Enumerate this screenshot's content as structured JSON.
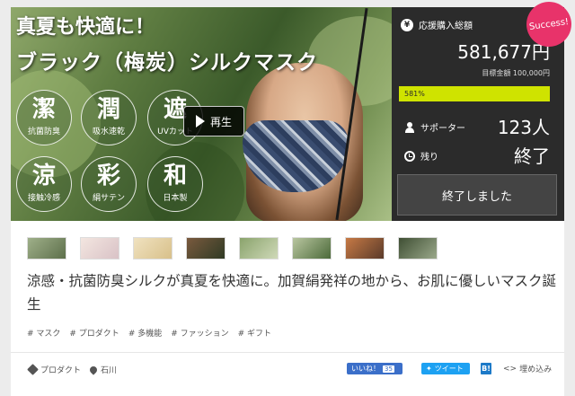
{
  "hero": {
    "title_line1": "真夏も快適に！",
    "title_line2": "ブラック（梅炭）シルクマスク",
    "play_label": "再生",
    "badges": [
      {
        "kanji": "潔",
        "sub": "抗菌防臭"
      },
      {
        "kanji": "潤",
        "sub": "吸水速乾"
      },
      {
        "kanji": "遮",
        "sub": "UVカット"
      },
      {
        "kanji": "涼",
        "sub": "接触冷感"
      },
      {
        "kanji": "彩",
        "sub": "絹サテン"
      },
      {
        "kanji": "和",
        "sub": "日本製"
      }
    ]
  },
  "panel": {
    "total_label": "応援購入総額",
    "amount": "581,677円",
    "goal": "目標金額 100,000円",
    "progress_label": "581%",
    "progress_fraction": 1.0,
    "supporters_label": "サポーター",
    "supporters_value": "123人",
    "remaining_label": "残り",
    "remaining_value": "終了",
    "ended_button": "終了しました",
    "success_badge": "Success!",
    "accent_color": "#cfe300"
  },
  "thumbnails": [
    "thumb-1",
    "thumb-2",
    "thumb-3",
    "thumb-4",
    "thumb-5",
    "thumb-6",
    "thumb-7",
    "thumb-8"
  ],
  "description": "涼感・抗菌防臭シルクが真夏を快適に。加賀絹発祥の地から、お肌に優しいマスク誕生",
  "tags": [
    "# マスク",
    "# プロダクト",
    "# 多機能",
    "# ファッション",
    "# ギフト"
  ],
  "footer": {
    "category": "プロダクト",
    "location": "石川",
    "like_label": "いいね！",
    "like_count": "35",
    "tweet_label": "ツイート",
    "hatena_label": "B!",
    "embed_label": "埋め込み"
  }
}
